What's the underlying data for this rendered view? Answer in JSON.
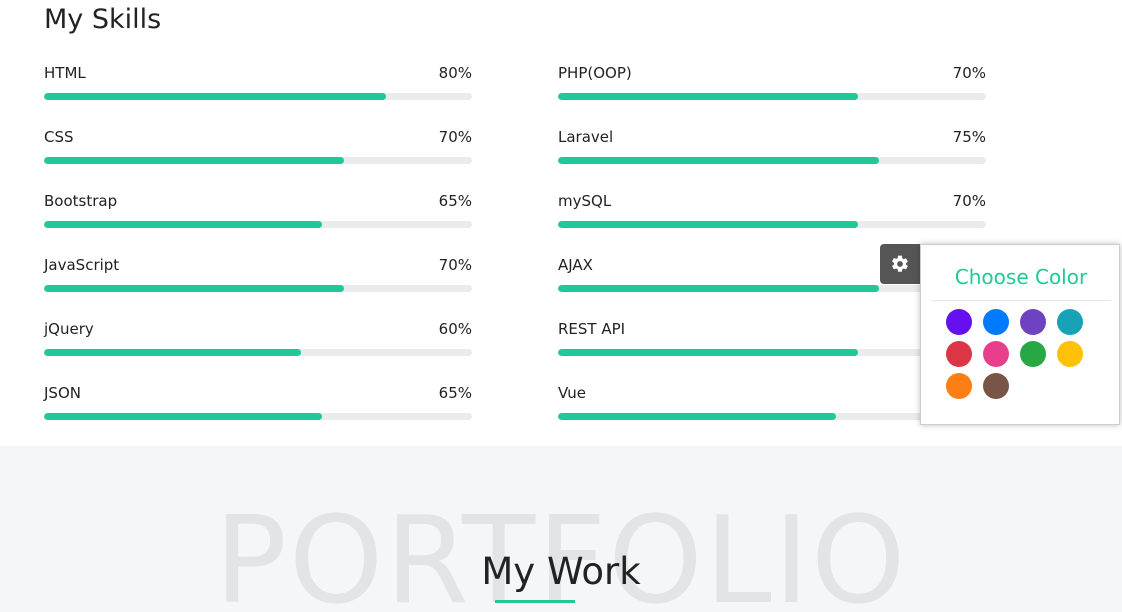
{
  "skills_section": {
    "title": "My Skills",
    "left_column": [
      {
        "name": "HTML",
        "percent_label": "80%",
        "level": 0.8
      },
      {
        "name": "CSS",
        "percent_label": "70%",
        "level": 0.7
      },
      {
        "name": "Bootstrap",
        "percent_label": "65%",
        "level": 0.65
      },
      {
        "name": "JavaScript",
        "percent_label": "70%",
        "level": 0.7
      },
      {
        "name": "jQuery",
        "percent_label": "60%",
        "level": 0.6
      },
      {
        "name": "JSON",
        "percent_label": "65%",
        "level": 0.65
      }
    ],
    "right_column": [
      {
        "name": "PHP(OOP)",
        "percent_label": "70%",
        "level": 0.7
      },
      {
        "name": "Laravel",
        "percent_label": "75%",
        "level": 0.75
      },
      {
        "name": "mySQL",
        "percent_label": "70%",
        "level": 0.7
      },
      {
        "name": "AJAX",
        "percent_label": "",
        "level": 0.75
      },
      {
        "name": "REST API",
        "percent_label": "",
        "level": 0.7
      },
      {
        "name": "Vue",
        "percent_label": "",
        "level": 0.65
      }
    ],
    "bar_color": "#20c997",
    "track_color": "#e9ecef"
  },
  "color_switcher": {
    "gear_icon": "gear-icon",
    "title": "Choose Color",
    "swatches": [
      "#6610f2",
      "#007bff",
      "#6f42c1",
      "#17a2b8",
      "#dc3545",
      "#e83e8c",
      "#28a745",
      "#ffc107",
      "#fd7e14",
      "#795548"
    ]
  },
  "portfolio_section": {
    "background_text": "PORTFOLIO",
    "title": "My Work",
    "accent_color": "#20c997"
  }
}
